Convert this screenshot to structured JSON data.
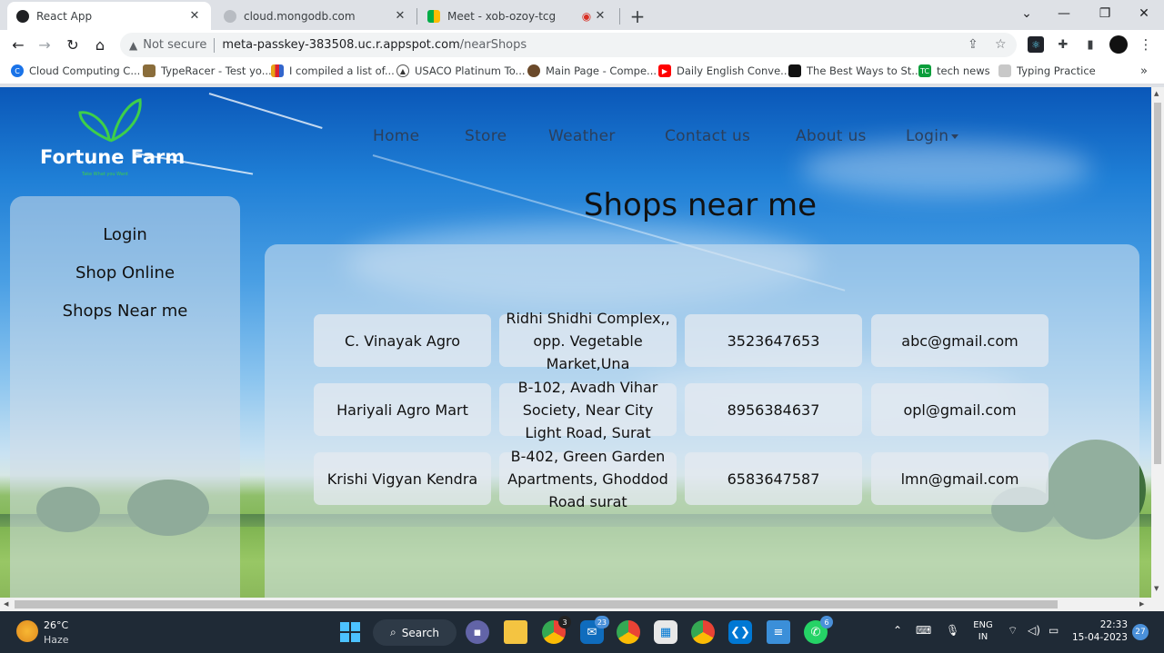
{
  "browser": {
    "tabs": [
      {
        "title": "React App",
        "active": true
      },
      {
        "title": "cloud.mongodb.com",
        "active": false
      },
      {
        "title": "Meet - xob-ozoy-tcg",
        "active": false
      }
    ],
    "new_tab": "+",
    "window_controls": {
      "down": "⌄",
      "minimize": "—",
      "restore": "❐",
      "close": "✕"
    },
    "security": "Not secure",
    "url_host": "meta-passkey-383508.uc.r.appspot.com",
    "url_path": "/nearShops",
    "bookmarks": [
      "Cloud Computing C...",
      "TypeRacer - Test yo...",
      "I compiled a list of...",
      "USACO Platinum To...",
      "Main Page - Compe...",
      "Daily English Conve...",
      "The Best Ways to St...",
      "tech news",
      "Typing Practice"
    ],
    "bookmarks_more": "»"
  },
  "site": {
    "brand": "Fortune Farm",
    "tagline": "Take What you Want",
    "nav": [
      "Home",
      "Store",
      "Weather",
      "Contact us",
      "About us",
      "Login"
    ],
    "sidebar": [
      "Login",
      "Shop Online",
      "Shops Near me"
    ],
    "heading": "Shops near me",
    "shops": [
      {
        "name": "C. Vinayak Agro",
        "address": "Ridhi Shidhi Complex,,\nopp. Vegetable\nMarket,Una",
        "phone": "3523647653",
        "email": "abc@gmail.com"
      },
      {
        "name": "Hariyali Agro Mart",
        "address": "B-102, Avadh Vihar\nSociety, Near City\nLight Road, Surat",
        "phone": "8956384637",
        "email": "opl@gmail.com"
      },
      {
        "name": "Krishi Vigyan Kendra",
        "address": "B-402, Green Garden\nApartments, Ghoddod\nRoad surat",
        "phone": "6583647587",
        "email": "lmn@gmail.com"
      }
    ]
  },
  "taskbar": {
    "weather_temp": "26°C",
    "weather_desc": "Haze",
    "search_label": "Search",
    "badge_chrome": "3",
    "badge_mail": "23",
    "badge_whatsapp": "6",
    "lang_1": "ENG",
    "lang_2": "IN",
    "time": "22:33",
    "date": "15-04-2023",
    "notif_count": "27"
  }
}
